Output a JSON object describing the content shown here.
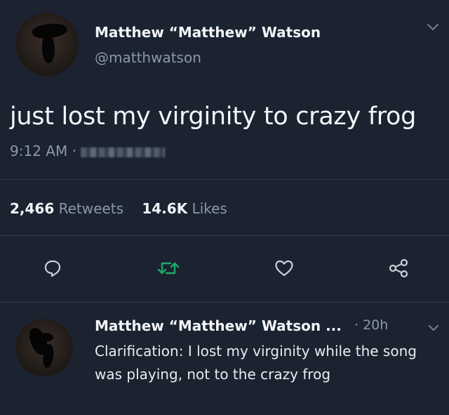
{
  "tweet": {
    "display_name": "Matthew “Matthew” Watson",
    "handle": "@matthwatson",
    "text": "just lost my virginity to crazy frog",
    "time": "9:12 AM ·",
    "retweets_count": "2,466",
    "retweets_label": "Retweets",
    "likes_count": "14.6K",
    "likes_label": "Likes"
  },
  "actions": {
    "reply_icon": "reply-bubble-icon",
    "retweet_icon": "retweet-icon",
    "like_icon": "heart-icon",
    "share_icon": "share-icon",
    "retweet_color": "#1faa6b"
  },
  "reply": {
    "display_name": "Matthew “Matthew” Watson ...",
    "time": "· 20h",
    "text": "Clarification: I lost my virginity while the song was playing, not to the crazy frog"
  }
}
